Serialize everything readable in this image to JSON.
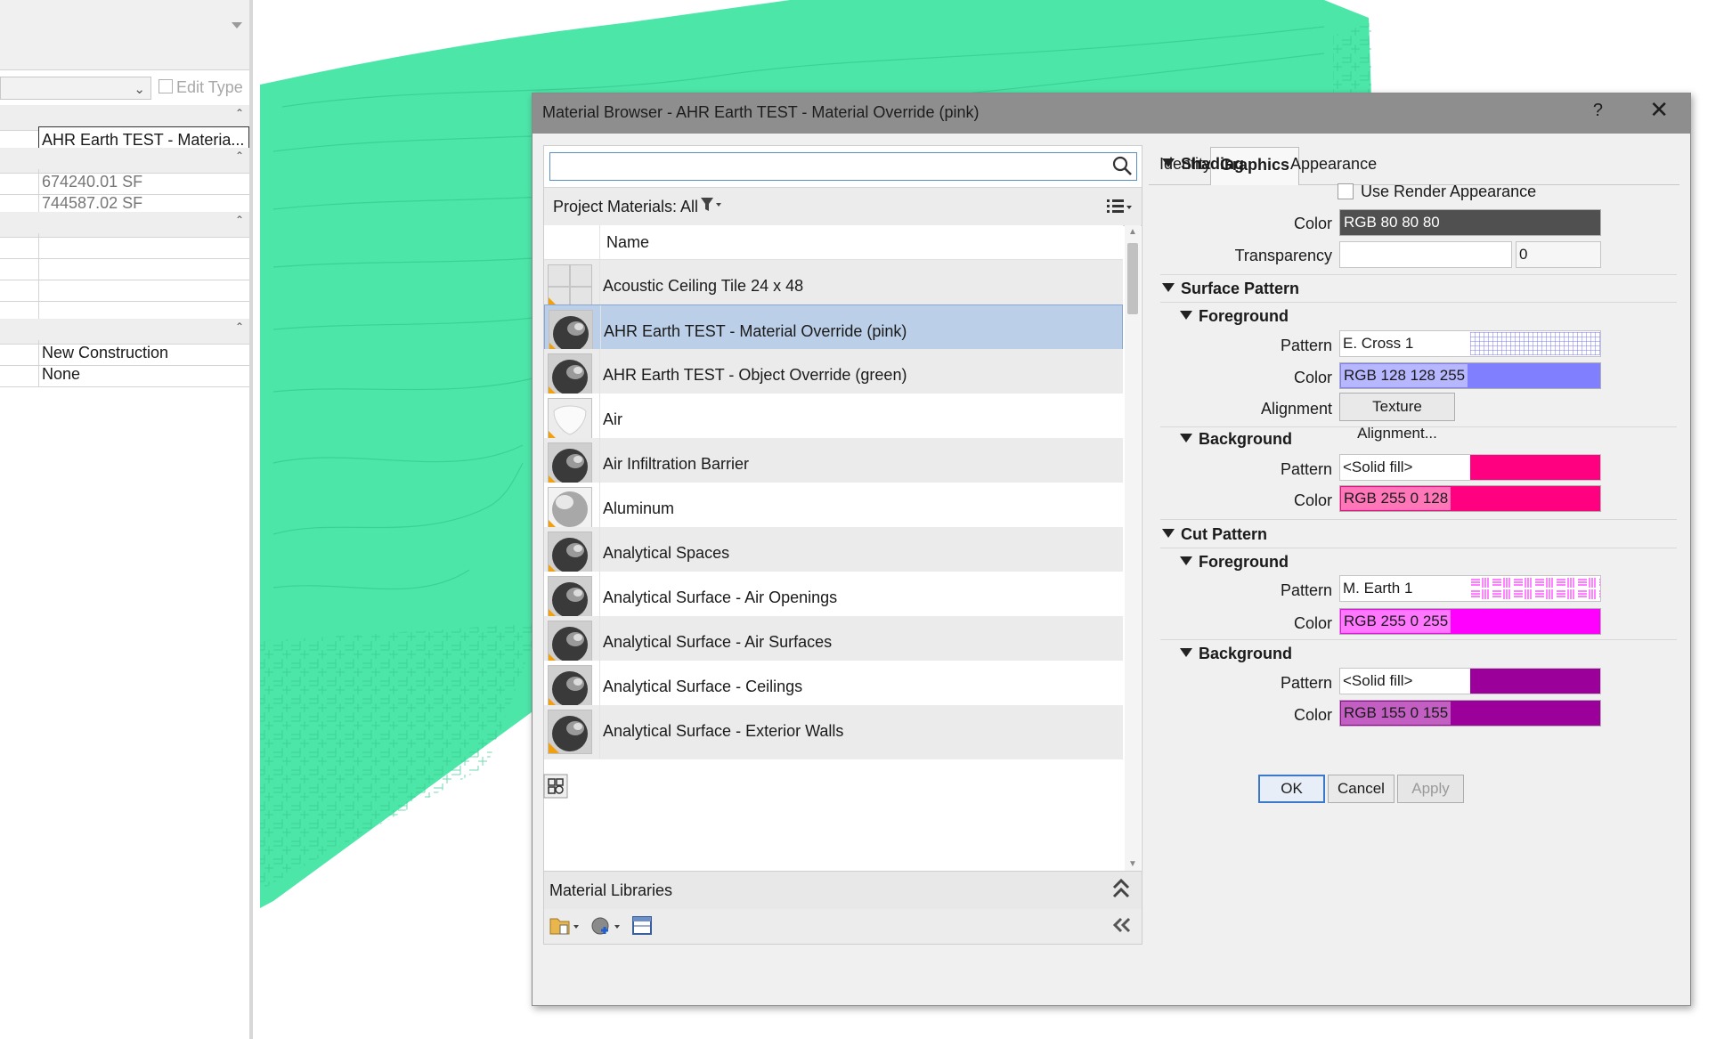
{
  "properties_palette": {
    "edit_type_label": "Edit Type",
    "rows": [
      {
        "kind": "group",
        "value": ""
      },
      {
        "kind": "value",
        "value": "AHR Earth TEST - Materia...",
        "style": "edit"
      },
      {
        "kind": "group",
        "value": ""
      },
      {
        "kind": "value",
        "value": "674240.01 SF",
        "style": "ro"
      },
      {
        "kind": "value",
        "value": "744587.02 SF",
        "style": "ro"
      },
      {
        "kind": "group",
        "value": ""
      },
      {
        "kind": "value",
        "value": ""
      },
      {
        "kind": "value",
        "value": ""
      },
      {
        "kind": "value",
        "value": ""
      },
      {
        "kind": "value",
        "value": ""
      },
      {
        "kind": "group",
        "value": ""
      },
      {
        "kind": "value",
        "value": "New Construction"
      },
      {
        "kind": "value",
        "value": "None"
      }
    ]
  },
  "view": {
    "toposurface_color": "#4de6a9",
    "line_color": "#3bd197"
  },
  "dialog": {
    "title": "Material Browser - AHR Earth TEST - Material Override (pink)",
    "help_label": "?",
    "close_label": "✕",
    "search": {
      "value": "",
      "placeholder": ""
    },
    "filter_label": "Project Materials: All",
    "list_header": "Name",
    "materials": [
      {
        "name": "Acoustic Ceiling Tile 24 x 48",
        "icon": "grid-tile-icon",
        "selected": false
      },
      {
        "name": "AHR Earth TEST - Material Override (pink)",
        "icon": "sphere-dark-icon",
        "selected": true
      },
      {
        "name": "AHR Earth TEST - Object Override (green)",
        "icon": "sphere-dark-icon",
        "selected": false
      },
      {
        "name": "Air",
        "icon": "cloud-icon",
        "selected": false
      },
      {
        "name": "Air Infiltration Barrier",
        "icon": "sphere-dark-icon",
        "selected": false
      },
      {
        "name": "Aluminum",
        "icon": "sphere-metal-icon",
        "selected": false
      },
      {
        "name": "Analytical Spaces",
        "icon": "sphere-dark-icon",
        "selected": false
      },
      {
        "name": "Analytical Surface - Air Openings",
        "icon": "sphere-dark-icon",
        "selected": false
      },
      {
        "name": "Analytical Surface - Air Surfaces",
        "icon": "sphere-dark-icon",
        "selected": false
      },
      {
        "name": "Analytical Surface - Ceilings",
        "icon": "sphere-dark-icon",
        "selected": false
      },
      {
        "name": "Analytical Surface - Exterior Walls",
        "icon": "sphere-dark-icon",
        "selected": false
      }
    ],
    "libraries_label": "Material Libraries",
    "tabs": [
      {
        "label": "Identity",
        "active": false
      },
      {
        "label": "Graphics",
        "active": true
      },
      {
        "label": "Appearance",
        "active": false
      }
    ],
    "shading": {
      "title": "Shading",
      "use_render_label": "Use Render Appearance",
      "use_render_checked": false,
      "color_label": "Color",
      "color_value": "RGB 80 80 80",
      "color_hex": "#505050",
      "transparency_label": "Transparency",
      "transparency_value": "0"
    },
    "surface_pattern": {
      "title": "Surface Pattern",
      "foreground": {
        "title": "Foreground",
        "pattern_label": "Pattern",
        "pattern_value": "E. Cross 1",
        "color_label": "Color",
        "color_value": "RGB 128 128 255",
        "color_hex": "#8080ff",
        "alignment_label": "Alignment",
        "alignment_button": "Texture Alignment..."
      },
      "background": {
        "title": "Background",
        "pattern_label": "Pattern",
        "pattern_value": "<Solid fill>",
        "color_label": "Color",
        "color_value": "RGB 255 0 128",
        "color_hex": "#ff0080"
      }
    },
    "cut_pattern": {
      "title": "Cut Pattern",
      "foreground": {
        "title": "Foreground",
        "pattern_label": "Pattern",
        "pattern_value": "M. Earth 1",
        "color_label": "Color",
        "color_value": "RGB 255 0 255",
        "color_hex": "#ff00ff"
      },
      "background": {
        "title": "Background",
        "pattern_label": "Pattern",
        "pattern_value": "<Solid fill>",
        "color_label": "Color",
        "color_value": "RGB 155 0 155",
        "color_hex": "#9b009b"
      }
    },
    "buttons": {
      "ok": "OK",
      "cancel": "Cancel",
      "apply": "Apply"
    }
  }
}
